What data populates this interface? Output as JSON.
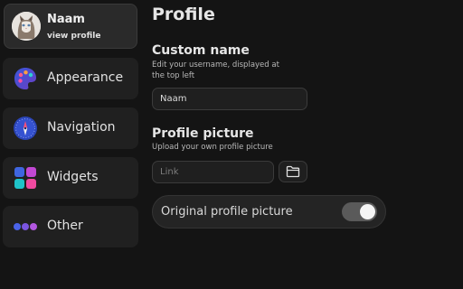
{
  "profile": {
    "name": "Naam",
    "subtitle": "view profile",
    "avatar_icon": "cat-avatar"
  },
  "sidebar": {
    "items": [
      {
        "label": "Appearance",
        "icon": "palette-icon"
      },
      {
        "label": "Navigation",
        "icon": "compass-icon"
      },
      {
        "label": "Widgets",
        "icon": "widgets-icon"
      },
      {
        "label": "Other",
        "icon": "dots-icon"
      }
    ]
  },
  "main": {
    "title": "Profile",
    "custom_name": {
      "title": "Custom name",
      "description": "Edit your username, displayed at the top left",
      "value": "Naam"
    },
    "profile_picture": {
      "title": "Profile picture",
      "description": "Upload your own profile picture",
      "placeholder": "Link",
      "upload_icon": "folder-icon"
    },
    "original_picture_toggle": {
      "label": "Original profile picture",
      "enabled": true
    }
  },
  "colors": {
    "background": "#141414",
    "card": "#202020",
    "switch_track": "#5a5a5a",
    "switch_knob": "#f4f4f4"
  }
}
